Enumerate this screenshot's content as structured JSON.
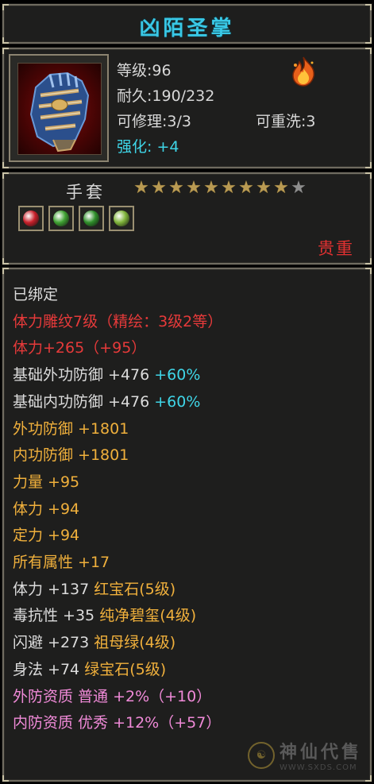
{
  "item": {
    "name": "凶陌圣掌",
    "level": "等级:96",
    "durability": "耐久:190/232",
    "repairable": "可修理:3/3",
    "rewashable": "可重洗:3",
    "strengthen_label": "强化:",
    "strengthen_value": "+4",
    "type": "手套",
    "stars_filled": 9,
    "stars_total": 10,
    "rarity": "贵重",
    "gems": [
      {
        "name": "ruby-gem-icon",
        "color": "#c8202a"
      },
      {
        "name": "emerald-gem-icon",
        "color": "#3fa232"
      },
      {
        "name": "green-gem-icon",
        "color": "#2f8f2a"
      },
      {
        "name": "jade-gem-icon",
        "color": "#7fb43a"
      }
    ]
  },
  "properties": [
    {
      "parts": [
        {
          "text": "已绑定",
          "color": "white"
        }
      ]
    },
    {
      "parts": [
        {
          "text": "体力雕纹7级（精绘：3级2等）",
          "color": "red"
        }
      ]
    },
    {
      "parts": [
        {
          "text": "体力+265（+95）",
          "color": "red"
        }
      ]
    },
    {
      "parts": [
        {
          "text": "基础外功防御 +476 ",
          "color": "white"
        },
        {
          "text": "+60%",
          "color": "cyan"
        }
      ]
    },
    {
      "parts": [
        {
          "text": "基础内功防御 +476 ",
          "color": "white"
        },
        {
          "text": "+60%",
          "color": "cyan"
        }
      ]
    },
    {
      "parts": [
        {
          "text": "外功防御 +1801",
          "color": "yellow"
        }
      ]
    },
    {
      "parts": [
        {
          "text": "内功防御 +1801",
          "color": "yellow"
        }
      ]
    },
    {
      "parts": [
        {
          "text": "力量 +95",
          "color": "yellow"
        }
      ]
    },
    {
      "parts": [
        {
          "text": "体力 +94",
          "color": "yellow"
        }
      ]
    },
    {
      "parts": [
        {
          "text": "定力 +94",
          "color": "yellow"
        }
      ]
    },
    {
      "parts": [
        {
          "text": "所有属性 +17",
          "color": "yellow"
        }
      ]
    },
    {
      "parts": [
        {
          "text": "体力 +137 ",
          "color": "white"
        },
        {
          "text": "红宝石(5级)",
          "color": "yellow"
        }
      ]
    },
    {
      "parts": [
        {
          "text": "毒抗性 +35 ",
          "color": "white"
        },
        {
          "text": "纯净碧玺(4级)",
          "color": "yellow"
        }
      ]
    },
    {
      "parts": [
        {
          "text": "闪避 +273 ",
          "color": "white"
        },
        {
          "text": "祖母绿(4级)",
          "color": "yellow"
        }
      ]
    },
    {
      "parts": [
        {
          "text": "身法 +74 ",
          "color": "white"
        },
        {
          "text": "绿宝石(5级)",
          "color": "yellow"
        }
      ]
    },
    {
      "parts": [
        {
          "text": "外防资质  普通 +2%（+10）",
          "color": "pink"
        }
      ]
    },
    {
      "parts": [
        {
          "text": "内防资质  优秀 +12%（+57）",
          "color": "pink"
        }
      ]
    }
  ],
  "watermark": {
    "name": "神仙代售",
    "url": "WWW.SXDS.COM"
  },
  "colors": {
    "title": "#39c8e6",
    "rarity": "#e23131",
    "star_on": "#b99a52",
    "star_off": "#8e8e8e"
  }
}
